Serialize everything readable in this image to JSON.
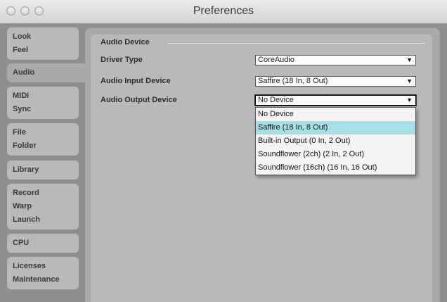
{
  "window": {
    "title": "Preferences"
  },
  "sidebar": {
    "tabs": [
      {
        "lines": [
          "Look",
          "Feel"
        ]
      },
      {
        "lines": [
          "Audio"
        ],
        "active": true
      },
      {
        "lines": [
          "MIDI",
          "Sync"
        ]
      },
      {
        "lines": [
          "File",
          "Folder"
        ]
      },
      {
        "lines": [
          "Library"
        ]
      },
      {
        "lines": [
          "Record",
          "Warp",
          "Launch"
        ]
      },
      {
        "lines": [
          "CPU"
        ]
      },
      {
        "lines": [
          "Licenses",
          "Maintenance"
        ]
      }
    ]
  },
  "audio": {
    "section_title": "Audio Device",
    "driver_type": {
      "label": "Driver Type",
      "value": "CoreAudio"
    },
    "input_device": {
      "label": "Audio Input Device",
      "value": "Saffire (18 In, 8 Out)"
    },
    "output_device": {
      "label": "Audio Output Device",
      "value": "No Device",
      "options": [
        "No Device",
        "Saffire (18 In, 8 Out)",
        "Built-in Output (0 In, 2 Out)",
        "Soundflower (2ch) (2 In, 2 Out)",
        "Soundflower (16ch) (16 In, 16 Out)"
      ],
      "highlighted_option": "Saffire (18 In, 8 Out)"
    }
  },
  "icons": {
    "dropdown_arrow": "▼"
  },
  "colors": {
    "highlight": "#a6dfe6"
  }
}
